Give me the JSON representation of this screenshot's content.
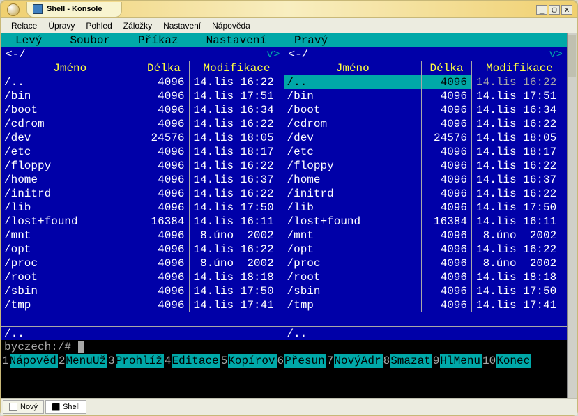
{
  "window": {
    "title": "Shell - Konsole"
  },
  "tb": {
    "min": "_",
    "max": "▢",
    "close": "x"
  },
  "menubar": [
    "Relace",
    "Úpravy",
    "Pohled",
    "Záložky",
    "Nastavení",
    "Nápověda"
  ],
  "mc_menu": [
    "Levý",
    "Soubor",
    "Příkaz",
    "Nastavení",
    "Pravý"
  ],
  "panel_path": {
    "left_arrow": "<-/",
    "v": "v>"
  },
  "headers": {
    "name": "Jméno",
    "size": "Délka",
    "time": "Modifikace"
  },
  "rows": [
    {
      "n": "/..",
      "s": "4096",
      "t": "14.lis 16:22",
      "sel_right": true
    },
    {
      "n": "/bin",
      "s": "4096",
      "t": "14.lis 17:51"
    },
    {
      "n": "/boot",
      "s": "4096",
      "t": "14.lis 16:34"
    },
    {
      "n": "/cdrom",
      "s": "4096",
      "t": "14.lis 16:22"
    },
    {
      "n": "/dev",
      "s": "24576",
      "t": "14.lis 18:05"
    },
    {
      "n": "/etc",
      "s": "4096",
      "t": "14.lis 18:17"
    },
    {
      "n": "/floppy",
      "s": "4096",
      "t": "14.lis 16:22"
    },
    {
      "n": "/home",
      "s": "4096",
      "t": "14.lis 16:37"
    },
    {
      "n": "/initrd",
      "s": "4096",
      "t": "14.lis 16:22"
    },
    {
      "n": "/lib",
      "s": "4096",
      "t": "14.lis 17:50"
    },
    {
      "n": "/lost+found",
      "s": "16384",
      "t": "14.lis 16:11"
    },
    {
      "n": "/mnt",
      "s": "4096",
      "t": " 8.úno  2002"
    },
    {
      "n": "/opt",
      "s": "4096",
      "t": "14.lis 16:22"
    },
    {
      "n": "/proc",
      "s": "4096",
      "t": " 8.úno  2002"
    },
    {
      "n": "/root",
      "s": "4096",
      "t": "14.lis 18:18"
    },
    {
      "n": "/sbin",
      "s": "4096",
      "t": "14.lis 17:50"
    },
    {
      "n": "/tmp",
      "s": "4096",
      "t": "14.lis 17:41"
    }
  ],
  "footer": "/..",
  "prompt": "byczech:/# ",
  "fkeys": [
    {
      "n": "1",
      "l": "Nápověd"
    },
    {
      "n": "2",
      "l": "MenuUž "
    },
    {
      "n": "3",
      "l": "Prohlíž"
    },
    {
      "n": "4",
      "l": "Editace"
    },
    {
      "n": "5",
      "l": "Kopírov"
    },
    {
      "n": "6",
      "l": "Přesun "
    },
    {
      "n": "7",
      "l": "NovýAdr"
    },
    {
      "n": "8",
      "l": "Smazat "
    },
    {
      "n": "9",
      "l": "HlMenu "
    },
    {
      "n": "10",
      "l": "Konec  "
    }
  ],
  "tabs": {
    "new": "Nový",
    "shell": "Shell"
  }
}
